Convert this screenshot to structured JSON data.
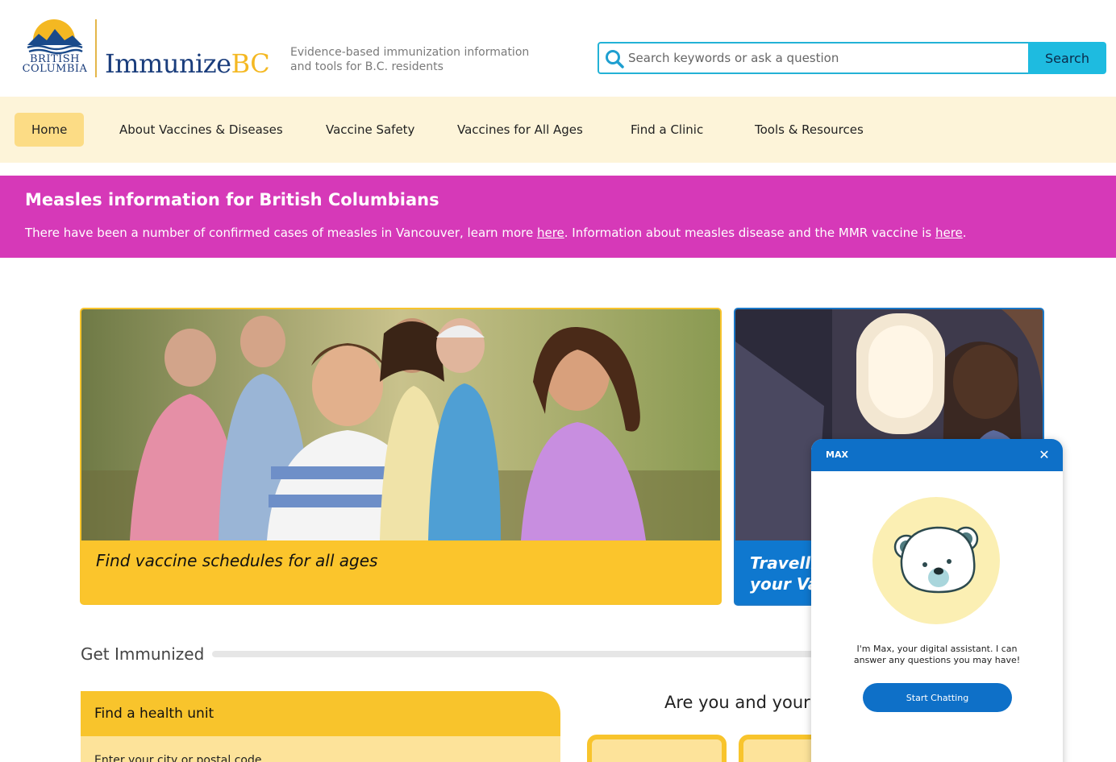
{
  "header": {
    "logo_gov_line1": "BRITISH",
    "logo_gov_line2": "COLUMBIA",
    "logo_name_main": "Immunize",
    "logo_name_accent": "BC",
    "tagline": "Evidence-based immunization information and tools for B.C. residents",
    "search_placeholder": "Search keywords or ask a question",
    "search_button": "Search"
  },
  "nav": {
    "items": [
      {
        "label": "Home",
        "active": true,
        "has_dropdown": false
      },
      {
        "label": "About Vaccines & Diseases",
        "has_dropdown": true
      },
      {
        "label": "Vaccine Safety",
        "has_dropdown": false
      },
      {
        "label": "Vaccines for All Ages",
        "has_dropdown": true
      },
      {
        "label": "Find a Clinic",
        "has_dropdown": true
      },
      {
        "label": "Tools & Resources",
        "has_dropdown": true
      }
    ]
  },
  "alert": {
    "title": "Measles information for British Columbians",
    "text_1": "There have been a number of confirmed cases of measles in Vancouver, learn more ",
    "link_1": "here",
    "text_2": ". Information about measles disease and  the MMR vaccine is ",
    "link_2": "here",
    "text_3": "."
  },
  "cards": [
    {
      "caption": "Find vaccine schedules for all ages"
    },
    {
      "caption_line1": "Travellin",
      "caption_line2": "your Vac"
    }
  ],
  "get_immunized": {
    "title": "Get Immunized",
    "health_unit_title": "Find a health unit",
    "health_unit_label": "Enter your city or postal code",
    "question": "Are you and your f"
  },
  "chat": {
    "title": "MAX",
    "close_icon": "close-icon",
    "message": "I'm Max, your digital assistant. I can answer any questions you may have!",
    "button": "Start Chatting"
  },
  "colors": {
    "brand_blue": "#1a3d7c",
    "brand_gold": "#f4b822",
    "nav_bg": "#fdf4d9",
    "alert_bg": "#d639b8",
    "search_accent": "#1ebbe0",
    "card_yellow": "#fbc52c",
    "card_blue": "#0f78cf",
    "chat_blue": "#0e70c8"
  }
}
